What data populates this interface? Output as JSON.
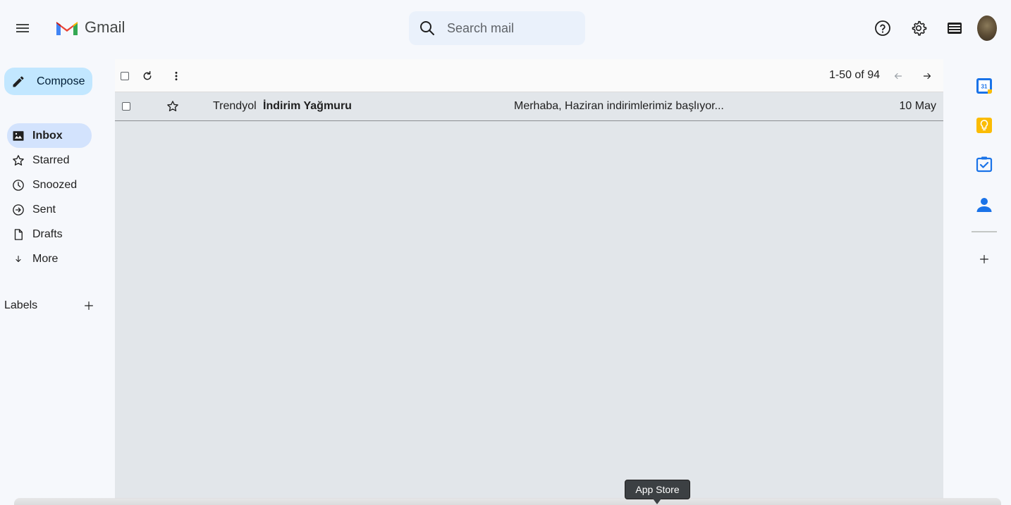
{
  "header": {
    "app_name": "Gmail",
    "search_placeholder": "Search mail"
  },
  "sidebar": {
    "compose_label": "Compose",
    "items": [
      {
        "label": "Inbox",
        "icon": "inbox-icon",
        "active": true
      },
      {
        "label": "Starred",
        "icon": "star-icon",
        "active": false
      },
      {
        "label": "Snoozed",
        "icon": "clock-icon",
        "active": false
      },
      {
        "label": "Sent",
        "icon": "send-icon",
        "active": false
      },
      {
        "label": "Drafts",
        "icon": "draft-icon",
        "active": false
      },
      {
        "label": "More",
        "icon": "chevron-down-icon",
        "active": false
      }
    ],
    "labels_heading": "Labels"
  },
  "toolbar": {
    "pager_text": "1-50 of 94"
  },
  "emails": [
    {
      "sender": "Trendyol",
      "subject": "İndirim Yağmuru",
      "snippet": "Merhaba, Haziran indirimlerimiz başlıyor...",
      "date": "10 May",
      "unread": true
    }
  ],
  "side_panel": {
    "calendar_day": "31",
    "apps": [
      "calendar-icon",
      "keep-icon",
      "tasks-icon",
      "contacts-icon"
    ]
  },
  "tooltip": {
    "text": "App Store"
  },
  "colors": {
    "compose_bg": "#c2e7ff",
    "active_nav_bg": "#d3e3fd",
    "calendar_blue": "#1a73e8",
    "keep_yellow": "#fbbc04"
  }
}
